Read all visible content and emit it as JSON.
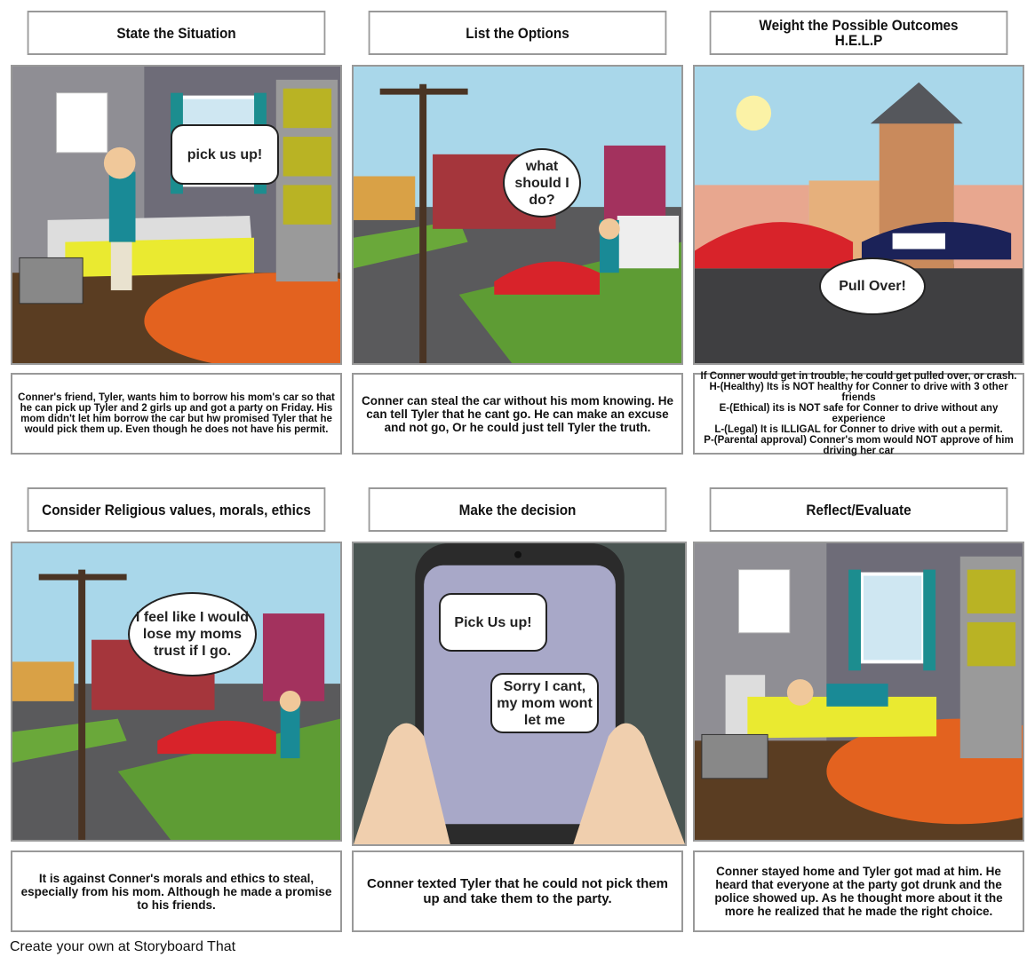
{
  "panels": [
    {
      "title": "State the Situation",
      "bubble": "pick us up!",
      "description": "Conner's friend, Tyler, wants him to borrow his mom's car so that he can pick up Tyler and 2 girls up and got a party on Friday. His mom didn't let him borrow the car but hw promised Tyler that he would pick them up. Even though he does not have his permit."
    },
    {
      "title": "List the Options",
      "bubble": "what should I do?",
      "description": "Conner can steal the car without his mom knowing. He can tell Tyler that he cant go. He can make an excuse and not go, Or he could just tell Tyler the truth."
    },
    {
      "title_lines": [
        "Weight the Possible Outcomes",
        "H.E.L.P"
      ],
      "bubble": "Pull Over!",
      "description": "If Conner would get in trouble, he could get pulled over, or crash.\nH-(Healthy) Its is NOT healthy for Conner to drive with 3 other friends\nE-(Ethical) its is NOT safe for Conner to drive without any experience\nL-(Legal) It is ILLIGAL for Conner to drive with out a permit.\nP-(Parental approval) Conner's mom would NOT approve of him driving her car"
    },
    {
      "title": "Consider Religious values, morals, ethics",
      "bubble": "I feel like I would lose my moms trust if I go.",
      "description": "It is against Conner's morals and ethics to steal, especially from his mom. Although he made a promise to his friends."
    },
    {
      "title": "Make the decision",
      "bubble": "Pick Us up!",
      "bubble2": "Sorry I cant, my mom wont let me",
      "description": "Conner texted Tyler that he could not pick them up and take them to the party."
    },
    {
      "title": "Reflect/Evaluate",
      "description": "Conner stayed home and Tyler got mad at him. He heard that everyone at the party got drunk and the police showed up. As he thought more about it the more he realized that he made the right choice."
    }
  ],
  "footer": "Create your own at Storyboard That"
}
